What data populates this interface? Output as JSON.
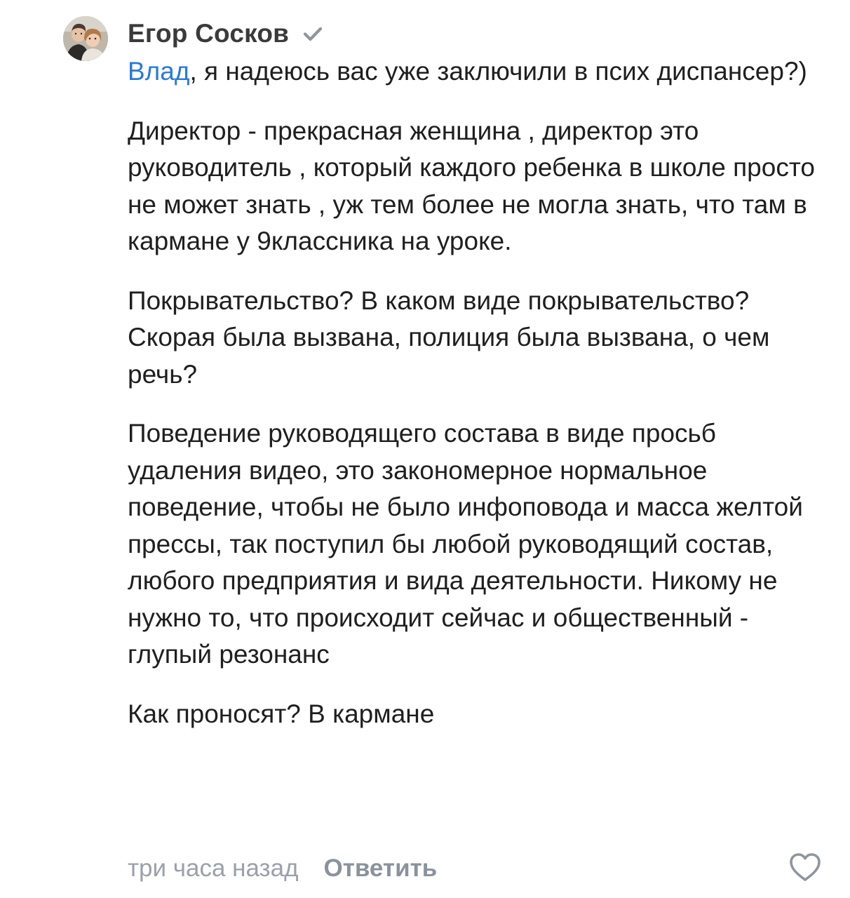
{
  "comment": {
    "author": "Егор Сосков",
    "verified_icon": "verified-check-icon",
    "avatar_icon": "avatar-photo",
    "mention": "Влад",
    "paragraph_1_rest": ", я надеюсь вас уже заключили в псих диспансер?)",
    "paragraph_2": "Директор - прекрасная женщина , директор это руководитель , который каждого ребенка в школе просто не может знать , уж тем более не могла знать, что там в кармане у 9классника на уроке.",
    "paragraph_3": "Покрывательство? В каком виде покрывательство? Скорая была вызвана, полиция была вызвана, о чем речь?",
    "paragraph_4": "Поведение руководящего состава в виде просьб удаления видео, это закономерное нормальное поведение, чтобы не было инфоповода и масса желтой прессы, так поступил бы любой руководящий состав, любого предприятия и вида деятельности. Никому не нужно то, что происходит сейчас и общественный - глупый резонанс",
    "paragraph_5": "Как проносят? В кармане",
    "timestamp": "три часа назад",
    "reply_label": "Ответить",
    "like_icon": "heart-outline-icon"
  },
  "colors": {
    "mention": "#2a7ad8",
    "text": "#1f1f1f",
    "meta": "#9aa1aa",
    "verified": "#8e959d"
  }
}
